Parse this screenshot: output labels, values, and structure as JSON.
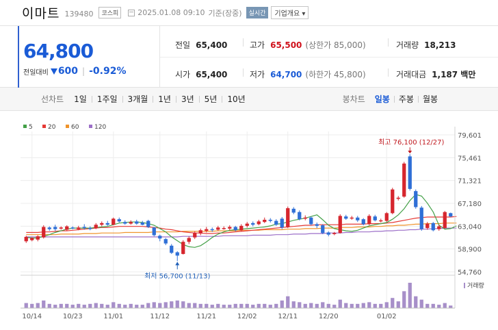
{
  "header": {
    "name": "이마트",
    "code": "139480",
    "market": "코스피",
    "datetime": "2025.01.08 09:10",
    "basis": "기준(장중)",
    "realtime_label": "실시간",
    "company_button": "기업개요 ▾"
  },
  "quote": {
    "price": "64,800",
    "change_label": "전일대비",
    "change": "600",
    "change_pct": "-0.92%",
    "prev_close_label": "전일",
    "prev_close": "65,400",
    "high_label": "고가",
    "high": "65,500",
    "upper_limit": "(상한가 85,000)",
    "volume_label": "거래량",
    "volume": "18,213",
    "open_label": "시가",
    "open": "65,400",
    "low_label": "저가",
    "low": "64,700",
    "lower_limit": "(하한가 45,800)",
    "amount_label": "거래대금",
    "amount": "1,187 백만"
  },
  "periods": {
    "line_label": "선차트",
    "line_items": [
      "1일",
      "1주일",
      "3개월",
      "1년",
      "3년",
      "5년",
      "10년"
    ],
    "candle_label": "봉차트",
    "candle_items": [
      "일봉",
      "주봉",
      "월봉"
    ],
    "active_candle": "일봉"
  },
  "colors": {
    "up": "#d6262e",
    "down": "#2f6fd6",
    "ma5": "#43a047",
    "ma20": "#e53935",
    "ma60": "#f0932a",
    "ma120": "#9c6fc8",
    "volume": "#a78fc9"
  },
  "chart_data": {
    "type": "candlestick",
    "legend": [
      {
        "name": "5",
        "color": "#43a047"
      },
      {
        "name": "20",
        "color": "#e53935"
      },
      {
        "name": "60",
        "color": "#f0932a"
      },
      {
        "name": "120",
        "color": "#9c6fc8"
      }
    ],
    "y_ticks": [
      "79,601",
      "75,461",
      "71,321",
      "67,180",
      "63,040",
      "58,900",
      "54,760"
    ],
    "ylim": [
      54760,
      79601
    ],
    "x_ticks": [
      "10/14",
      "10/23",
      "11/01",
      "11/12",
      "11/21",
      "12/02",
      "12/11",
      "12/20",
      "01/02"
    ],
    "annotations": {
      "high": "최고 76,100 (12/27)",
      "low": "최저 56,700 (11/13)"
    },
    "volume_label": "거래량",
    "candles": [
      {
        "o": 60300,
        "c": 61100,
        "h": 61300,
        "l": 60000,
        "v": 6
      },
      {
        "o": 60500,
        "c": 60900,
        "h": 61000,
        "l": 60300,
        "v": 5
      },
      {
        "o": 60600,
        "c": 61200,
        "h": 61400,
        "l": 60300,
        "v": 6
      },
      {
        "o": 61000,
        "c": 62900,
        "h": 63200,
        "l": 60800,
        "v": 9
      },
      {
        "o": 62800,
        "c": 62500,
        "h": 63000,
        "l": 62200,
        "v": 5
      },
      {
        "o": 62900,
        "c": 62500,
        "h": 63300,
        "l": 62200,
        "v": 4
      },
      {
        "o": 62600,
        "c": 62800,
        "h": 63000,
        "l": 62400,
        "v": 5
      },
      {
        "o": 62400,
        "c": 63000,
        "h": 63200,
        "l": 62200,
        "v": 5
      },
      {
        "o": 62800,
        "c": 62700,
        "h": 63000,
        "l": 62500,
        "v": 4
      },
      {
        "o": 62500,
        "c": 62800,
        "h": 63100,
        "l": 62300,
        "v": 5
      },
      {
        "o": 62900,
        "c": 62700,
        "h": 63400,
        "l": 62400,
        "v": 4
      },
      {
        "o": 62700,
        "c": 62600,
        "h": 63000,
        "l": 62300,
        "v": 5
      },
      {
        "o": 62700,
        "c": 63300,
        "h": 63600,
        "l": 62500,
        "v": 6
      },
      {
        "o": 63300,
        "c": 63600,
        "h": 63900,
        "l": 63000,
        "v": 5
      },
      {
        "o": 63600,
        "c": 63300,
        "h": 64000,
        "l": 63100,
        "v": 4
      },
      {
        "o": 63300,
        "c": 64400,
        "h": 64600,
        "l": 63200,
        "v": 7
      },
      {
        "o": 64300,
        "c": 63900,
        "h": 64600,
        "l": 63700,
        "v": 5
      },
      {
        "o": 63800,
        "c": 63500,
        "h": 64100,
        "l": 63300,
        "v": 4
      },
      {
        "o": 63500,
        "c": 63800,
        "h": 64100,
        "l": 63300,
        "v": 5
      },
      {
        "o": 63900,
        "c": 63500,
        "h": 64200,
        "l": 63300,
        "v": 4
      },
      {
        "o": 63700,
        "c": 63300,
        "h": 64000,
        "l": 63200,
        "v": 4
      },
      {
        "o": 64000,
        "c": 62900,
        "h": 64200,
        "l": 62700,
        "v": 6
      },
      {
        "o": 62800,
        "c": 61400,
        "h": 62900,
        "l": 61200,
        "v": 7
      },
      {
        "o": 61300,
        "c": 60800,
        "h": 61500,
        "l": 60300,
        "v": 6
      },
      {
        "o": 60700,
        "c": 59900,
        "h": 60900,
        "l": 59600,
        "v": 7
      },
      {
        "o": 59500,
        "c": 58200,
        "h": 59800,
        "l": 58000,
        "v": 8
      },
      {
        "o": 58300,
        "c": 57700,
        "h": 58500,
        "l": 56700,
        "v": 9
      },
      {
        "o": 58000,
        "c": 60200,
        "h": 60500,
        "l": 57900,
        "v": 8
      },
      {
        "o": 60200,
        "c": 60900,
        "h": 61200,
        "l": 59800,
        "v": 6
      },
      {
        "o": 61000,
        "c": 61800,
        "h": 62100,
        "l": 60700,
        "v": 6
      },
      {
        "o": 61700,
        "c": 62300,
        "h": 62600,
        "l": 61400,
        "v": 5
      },
      {
        "o": 62200,
        "c": 62500,
        "h": 62900,
        "l": 61900,
        "v": 5
      },
      {
        "o": 62500,
        "c": 62400,
        "h": 62800,
        "l": 62000,
        "v": 4
      },
      {
        "o": 62400,
        "c": 62800,
        "h": 63100,
        "l": 62200,
        "v": 5
      },
      {
        "o": 62700,
        "c": 62700,
        "h": 63000,
        "l": 62400,
        "v": 4
      },
      {
        "o": 62600,
        "c": 62900,
        "h": 63200,
        "l": 62300,
        "v": 4
      },
      {
        "o": 62900,
        "c": 62300,
        "h": 63100,
        "l": 62100,
        "v": 5
      },
      {
        "o": 62300,
        "c": 63100,
        "h": 63400,
        "l": 62100,
        "v": 5
      },
      {
        "o": 63100,
        "c": 63500,
        "h": 63800,
        "l": 62800,
        "v": 5
      },
      {
        "o": 63600,
        "c": 63300,
        "h": 63900,
        "l": 63000,
        "v": 4
      },
      {
        "o": 63400,
        "c": 63900,
        "h": 64200,
        "l": 63200,
        "v": 5
      },
      {
        "o": 63800,
        "c": 64200,
        "h": 64600,
        "l": 63600,
        "v": 5
      },
      {
        "o": 64200,
        "c": 64000,
        "h": 64500,
        "l": 63700,
        "v": 4
      },
      {
        "o": 64000,
        "c": 63300,
        "h": 64300,
        "l": 63100,
        "v": 5
      },
      {
        "o": 64400,
        "c": 62800,
        "h": 64700,
        "l": 62500,
        "v": 9
      },
      {
        "o": 62900,
        "c": 66300,
        "h": 66600,
        "l": 62700,
        "v": 14
      },
      {
        "o": 66200,
        "c": 65500,
        "h": 66500,
        "l": 65200,
        "v": 8
      },
      {
        "o": 65600,
        "c": 64300,
        "h": 65900,
        "l": 64100,
        "v": 7
      },
      {
        "o": 64400,
        "c": 64600,
        "h": 65000,
        "l": 64100,
        "v": 5
      },
      {
        "o": 64600,
        "c": 63400,
        "h": 64800,
        "l": 63200,
        "v": 6
      },
      {
        "o": 63400,
        "c": 63100,
        "h": 63700,
        "l": 62700,
        "v": 5
      },
      {
        "o": 63200,
        "c": 61800,
        "h": 63400,
        "l": 61600,
        "v": 7
      },
      {
        "o": 61900,
        "c": 61500,
        "h": 62100,
        "l": 61200,
        "v": 5
      },
      {
        "o": 61600,
        "c": 61800,
        "h": 62000,
        "l": 61400,
        "v": 4
      },
      {
        "o": 61800,
        "c": 64900,
        "h": 65200,
        "l": 61700,
        "v": 10
      },
      {
        "o": 64800,
        "c": 64400,
        "h": 65100,
        "l": 64200,
        "v": 6
      },
      {
        "o": 64500,
        "c": 64600,
        "h": 64900,
        "l": 64200,
        "v": 5
      },
      {
        "o": 64600,
        "c": 64100,
        "h": 64900,
        "l": 63800,
        "v": 5
      },
      {
        "o": 64300,
        "c": 63400,
        "h": 64500,
        "l": 63200,
        "v": 6
      },
      {
        "o": 63400,
        "c": 64900,
        "h": 65200,
        "l": 63200,
        "v": 7
      },
      {
        "o": 64800,
        "c": 64100,
        "h": 65100,
        "l": 63900,
        "v": 5
      },
      {
        "o": 64000,
        "c": 64100,
        "h": 64400,
        "l": 63700,
        "v": 5
      },
      {
        "o": 64000,
        "c": 65400,
        "h": 65600,
        "l": 63800,
        "v": 7
      },
      {
        "o": 65400,
        "c": 69700,
        "h": 70000,
        "l": 65200,
        "v": 12
      },
      {
        "o": 68000,
        "c": 68200,
        "h": 68500,
        "l": 67700,
        "v": 8
      },
      {
        "o": 68400,
        "c": 74400,
        "h": 74700,
        "l": 68200,
        "v": 20
      },
      {
        "o": 75700,
        "c": 69800,
        "h": 76100,
        "l": 69500,
        "v": 30
      },
      {
        "o": 69400,
        "c": 66500,
        "h": 69700,
        "l": 66200,
        "v": 14
      },
      {
        "o": 66400,
        "c": 62500,
        "h": 66700,
        "l": 62200,
        "v": 10
      },
      {
        "o": 62700,
        "c": 63500,
        "h": 63800,
        "l": 62400,
        "v": 5
      },
      {
        "o": 63600,
        "c": 62300,
        "h": 63800,
        "l": 62100,
        "v": 5
      },
      {
        "o": 62500,
        "c": 63000,
        "h": 63300,
        "l": 62200,
        "v": 4
      },
      {
        "o": 62700,
        "c": 65600,
        "h": 65800,
        "l": 62600,
        "v": 6
      },
      {
        "o": 65400,
        "c": 64800,
        "h": 65500,
        "l": 64700,
        "v": 3
      }
    ],
    "ma5": [
      61000,
      60900,
      60900,
      61200,
      61500,
      61900,
      62200,
      62500,
      62700,
      62700,
      62700,
      62700,
      62800,
      62900,
      63000,
      63300,
      63600,
      63700,
      63800,
      63800,
      63700,
      63500,
      63200,
      62600,
      62000,
      61100,
      60400,
      59700,
      59300,
      59200,
      59500,
      60200,
      61000,
      61600,
      62000,
      62300,
      62400,
      62500,
      62600,
      62700,
      62800,
      62900,
      63100,
      63400,
      63500,
      63800,
      64100,
      64300,
      64500,
      64800,
      65100,
      64200,
      63200,
      62600,
      62400,
      62200,
      62100,
      62300,
      62700,
      63100,
      63300,
      63500,
      63700,
      64300,
      65100,
      66200,
      67700,
      68800,
      68500,
      67200,
      65600,
      63200,
      62500,
      62600,
      63100
    ],
    "ma20": [
      61900,
      61900,
      61900,
      62000,
      62000,
      62100,
      62200,
      62200,
      62300,
      62400,
      62500,
      62600,
      62700,
      62800,
      62800,
      62900,
      63000,
      63000,
      63000,
      63000,
      63000,
      62900,
      62800,
      62700,
      62500,
      62400,
      62200,
      62000,
      61900,
      61800,
      61800,
      61700,
      61700,
      61800,
      61800,
      61900,
      62000,
      62100,
      62200,
      62300,
      62400,
      62500,
      62600,
      62700,
      62800,
      62900,
      63000,
      63100,
      63200,
      63200,
      63300,
      63300,
      63300,
      63300,
      63300,
      63400,
      63400,
      63400,
      63400,
      63500,
      63500,
      63500,
      63600,
      63700,
      63900,
      64100,
      64300,
      64500,
      64600,
      64700,
      64700,
      64700,
      64700,
      64700,
      64800
    ],
    "ma60": [
      61500,
      61500,
      61500,
      61500,
      61500,
      61500,
      61600,
      61600,
      61600,
      61600,
      61700,
      61700,
      61700,
      61800,
      61800,
      61800,
      61800,
      61900,
      61900,
      61900,
      61900,
      61900,
      62000,
      62000,
      62000,
      62000,
      62000,
      62100,
      62100,
      62100,
      62100,
      62100,
      62100,
      62200,
      62200,
      62200,
      62200,
      62300,
      62300,
      62300,
      62300,
      62400,
      62400,
      62400,
      62400,
      62500,
      62500,
      62500,
      62600,
      62600,
      62600,
      62700,
      62700,
      62700,
      62800,
      62800,
      62800,
      62900,
      62900,
      62900,
      63000,
      63000,
      63100,
      63100,
      63200,
      63200,
      63300,
      63400,
      63400,
      63500,
      63500,
      63500,
      63600,
      63600,
      63600
    ],
    "ma120": [
      61100,
      61100,
      61100,
      61100,
      61100,
      61100,
      61100,
      61100,
      61100,
      61100,
      61100,
      61100,
      61100,
      61100,
      61100,
      61100,
      61100,
      61100,
      61100,
      61100,
      61100,
      61100,
      61100,
      61100,
      61100,
      61100,
      61100,
      61200,
      61200,
      61200,
      61200,
      61200,
      61200,
      61200,
      61300,
      61300,
      61300,
      61300,
      61300,
      61400,
      61400,
      61400,
      61400,
      61500,
      61500,
      61500,
      61600,
      61600,
      61600,
      61700,
      61700,
      61700,
      61800,
      61800,
      61800,
      61900,
      61900,
      62000,
      62000,
      62000,
      62100,
      62100,
      62200,
      62200,
      62300,
      62300,
      62400,
      62400,
      62500,
      62500,
      62600,
      62600,
      62700,
      62700,
      62700
    ]
  }
}
